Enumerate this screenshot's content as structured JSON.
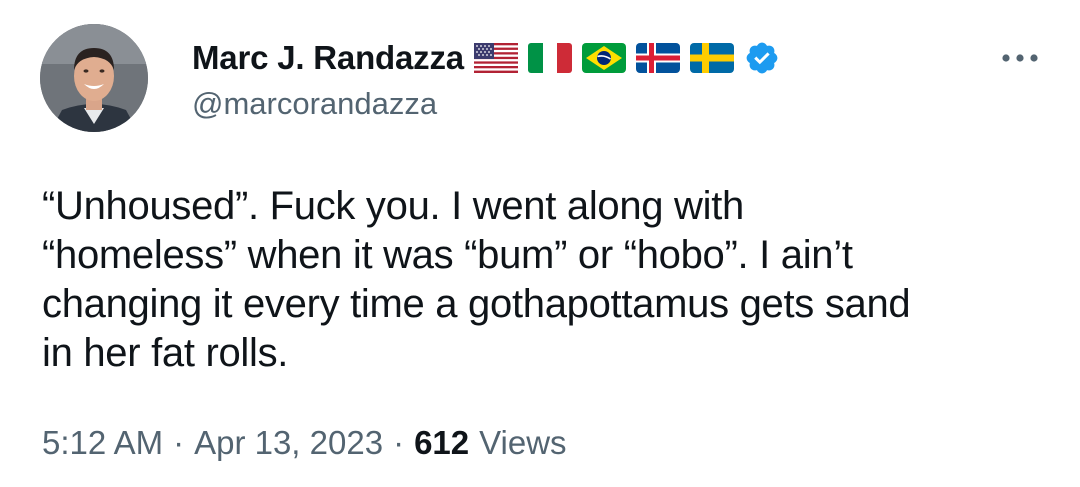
{
  "author": {
    "display_name": "Marc J. Randazza",
    "handle": "@marcorandazza",
    "flags": [
      "flag-usa-icon",
      "flag-italy-icon",
      "flag-brazil-icon",
      "flag-iceland-icon",
      "flag-sweden-icon"
    ],
    "verified_icon": "verified-badge-icon",
    "verified_color": "#1d9bf0"
  },
  "menu": {
    "icon": "more-horizontal-icon"
  },
  "tweet": {
    "text": "“Unhoused”.  Fuck you.  I went along with\n“homeless” when it was “bum” or “hobo”.  I ain’t\nchanging it every time a gothapottamus gets sand\nin her fat rolls."
  },
  "meta": {
    "time": "5:12 AM",
    "separator": "·",
    "date": "Apr 13, 2023",
    "views_count": "612",
    "views_label": "Views"
  },
  "colors": {
    "text_primary": "#0f1419",
    "text_secondary": "#536471",
    "background": "#ffffff"
  }
}
